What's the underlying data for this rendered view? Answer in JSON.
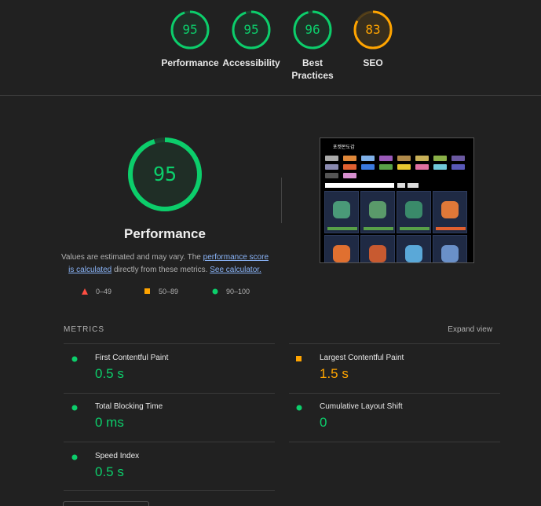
{
  "categories": [
    {
      "name": "Performance",
      "score": "95",
      "color": "#0cce6b",
      "value": 0.95
    },
    {
      "name": "Accessibility",
      "score": "95",
      "color": "#0cce6b",
      "value": 0.95
    },
    {
      "name": "Best Practices",
      "score": "96",
      "color": "#0cce6b",
      "value": 0.96
    },
    {
      "name": "SEO",
      "score": "83",
      "color": "#ffa400",
      "value": 0.83
    }
  ],
  "main": {
    "score": "95",
    "value": 0.95,
    "title": "Performance",
    "desc_part1": "Values are estimated and may vary. The ",
    "desc_link1": "performance score is calculated",
    "desc_part2": " directly from these metrics. ",
    "desc_link2": "See calculator."
  },
  "legend": [
    {
      "range": "0–49",
      "color": "#ff4e42",
      "shape": "triangle-icon"
    },
    {
      "range": "50–89",
      "color": "#ffa400",
      "shape": "square-icon"
    },
    {
      "range": "90–100",
      "color": "#0cce6b",
      "shape": "circle-icon"
    }
  ],
  "screenshot": {
    "header_text": "포켓몬도감"
  },
  "metrics": {
    "heading": "METRICS",
    "expand_label": "Expand view",
    "items": [
      {
        "name": "First Contentful Paint",
        "value": "0.5 s",
        "status": "good"
      },
      {
        "name": "Largest Contentful Paint",
        "value": "1.5 s",
        "status": "average"
      },
      {
        "name": "Total Blocking Time",
        "value": "0 ms",
        "status": "good"
      },
      {
        "name": "Cumulative Layout Shift",
        "value": "0",
        "status": "good"
      },
      {
        "name": "Speed Index",
        "value": "0.5 s",
        "status": "good"
      }
    ]
  },
  "colors": {
    "good": "#0cce6b",
    "average": "#ffa400",
    "fail": "#ff4e42"
  }
}
